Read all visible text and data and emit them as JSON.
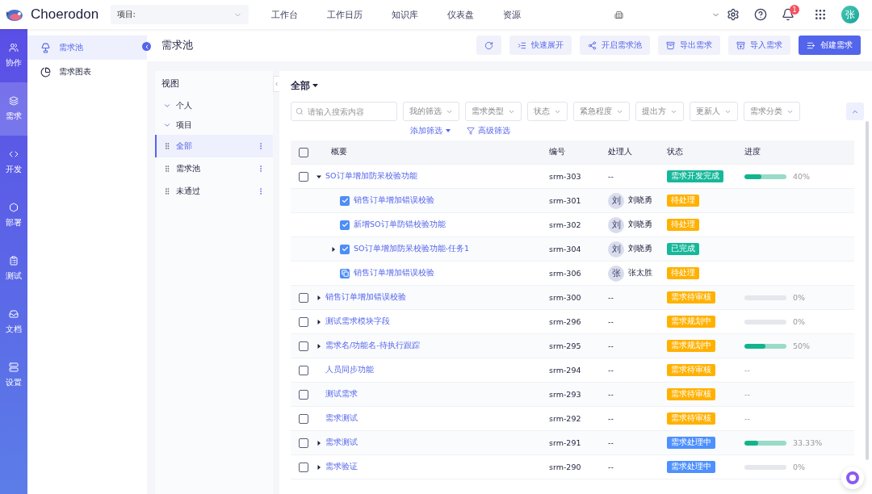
{
  "topbar": {
    "logo": "Choerodon",
    "project_select": {
      "label": "项目:"
    },
    "nav": [
      {
        "label": "工作台",
        "selected": false
      },
      {
        "label": "工作日历",
        "selected": false
      },
      {
        "label": "知识库",
        "selected": false
      },
      {
        "label": "仪表盘",
        "selected": false
      },
      {
        "label": "资源",
        "selected": false
      }
    ],
    "notification_count": "1",
    "avatar": "张"
  },
  "rail": [
    {
      "label": "协作",
      "selected": false
    },
    {
      "label": "需求",
      "selected": true
    },
    {
      "label": "开发",
      "selected": false
    },
    {
      "label": "部署",
      "selected": false
    },
    {
      "label": "测试",
      "selected": false
    },
    {
      "label": "文档",
      "selected": false
    },
    {
      "label": "设置",
      "selected": false
    }
  ],
  "sidebar": [
    {
      "label": "需求池",
      "selected": true
    },
    {
      "label": "需求图表",
      "selected": false
    }
  ],
  "page_title": "需求池",
  "toolbar": [
    {
      "kind": "refresh"
    },
    {
      "kind": "expand",
      "label": "快速展开"
    },
    {
      "kind": "share",
      "label": "开启需求池"
    },
    {
      "kind": "export",
      "label": "导出需求"
    },
    {
      "kind": "import",
      "label": "导入需求"
    },
    {
      "kind": "primary",
      "label": "创建需求"
    }
  ],
  "views": {
    "title": "视图",
    "groups": [
      {
        "label": "个人",
        "expanded": true
      },
      {
        "label": "项目",
        "expanded": true,
        "children": [
          {
            "label": "全部",
            "selected": true
          },
          {
            "label": "需求池",
            "selected": false
          },
          {
            "label": "未通过",
            "selected": false
          }
        ]
      }
    ]
  },
  "current_view": "全部",
  "search": {
    "placeholder": "请输入搜索内容"
  },
  "filters": [
    "我的筛选",
    "需求类型",
    "状态",
    "紧急程度",
    "提出方",
    "更新人",
    "需求分类"
  ],
  "add_filter": "添加筛选",
  "advanced_filter": "高级筛选",
  "table": {
    "select_all_checked": false,
    "columns": [
      "概要",
      "编号",
      "处理人",
      "状态",
      "进度"
    ],
    "rows": [
      {
        "checked": false,
        "summary": "SO订单增加防呆校验功能",
        "expanded": true,
        "number": "srm-303",
        "assignee": "--",
        "status": "需求开发完成",
        "color": "#16b89a",
        "progress": {
          "level": 0.4,
          "reading": "40%"
        },
        "children": [
          {
            "kind": "task",
            "summary": "销售订单增加错误校验",
            "number": "srm-301",
            "assignee": "刘晓勇",
            "avatar": "刘",
            "status": "待处理",
            "color": "#ffb100"
          },
          {
            "kind": "task",
            "summary": "新增SO订单防错校验功能",
            "number": "srm-302",
            "assignee": "刘晓勇",
            "avatar": "刘",
            "status": "待处理",
            "color": "#ffb100"
          },
          {
            "kind": "task",
            "summary": "SO订单增加防呆校验功能-任务1",
            "expanded": false,
            "number": "srm-304",
            "assignee": "刘晓勇",
            "avatar": "刘",
            "status": "已完成",
            "color": "#16b89a"
          },
          {
            "kind": "copy",
            "summary": "销售订单增加错误校验",
            "number": "srm-306",
            "assignee": "张太胜",
            "avatar": "张",
            "status": "待处理",
            "color": "#ffb100"
          }
        ]
      },
      {
        "checked": false,
        "summary": "销售订单增加错误校验",
        "expanded": false,
        "number": "srm-300",
        "assignee": "--",
        "status": "需求待审核",
        "color": "#ffb100",
        "progress": {
          "level": 0,
          "reading": "0%"
        }
      },
      {
        "checked": false,
        "summary": "测试需求模块字段",
        "expanded": false,
        "number": "srm-296",
        "assignee": "--",
        "status": "需求规划中",
        "color": "#ffb100",
        "progress": {
          "level": 0,
          "reading": "0%"
        }
      },
      {
        "checked": false,
        "summary": "需求名/功能名-待执行跟踪",
        "expanded": false,
        "number": "srm-295",
        "assignee": "--",
        "status": "需求规划中",
        "color": "#ffb100",
        "progress": {
          "level": 0.5,
          "reading": "50%"
        }
      },
      {
        "checked": false,
        "summary": "人员同步功能",
        "number": "srm-294",
        "assignee": "--",
        "status": "需求待审核",
        "color": "#ffb100",
        "progress": {
          "reading": "--"
        }
      },
      {
        "checked": false,
        "summary": "测试需求",
        "number": "srm-293",
        "assignee": "--",
        "status": "需求待审核",
        "color": "#ffb100",
        "progress": {
          "reading": "--"
        }
      },
      {
        "checked": false,
        "summary": "需求测试",
        "number": "srm-292",
        "assignee": "--",
        "status": "需求待审核",
        "color": "#ffb100",
        "progress": {
          "reading": "--"
        }
      },
      {
        "checked": false,
        "summary": "需求测试",
        "expanded": false,
        "number": "srm-291",
        "assignee": "--",
        "status": "需求处理中",
        "color": "#4d90fe",
        "progress": {
          "level": 0.3333,
          "reading": "33.33%"
        }
      },
      {
        "checked": false,
        "summary": "需求验证",
        "expanded": false,
        "number": "srm-290",
        "assignee": "--",
        "status": "需求处理中",
        "color": "#4d90fe",
        "progress": {
          "level": 0,
          "reading": "0%"
        }
      }
    ]
  }
}
